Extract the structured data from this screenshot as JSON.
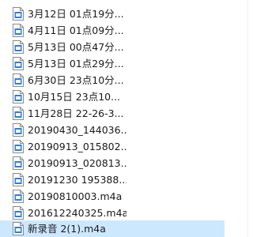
{
  "files": [
    {
      "name": "3月12日 01点19分..."
    },
    {
      "name": "4月11日 01点09分..."
    },
    {
      "name": "5月13日 00点47分..."
    },
    {
      "name": "5月13日 01点29分..."
    },
    {
      "name": "6月30日 23点10分..."
    },
    {
      "name": "10月15日 23点10..."
    },
    {
      "name": "11月28日 22-26-3..."
    },
    {
      "name": "20190430_144036...."
    },
    {
      "name": "20190913_015802...."
    },
    {
      "name": "20190913_020813...."
    },
    {
      "name": "20191230 195388...."
    },
    {
      "name": "20190810003.m4a"
    },
    {
      "name": "201612240325.m4a"
    },
    {
      "name": "新录音 2(1).m4a",
      "selected": true
    }
  ],
  "icon": "audio-file-icon",
  "colors": {
    "selection": "#cce8ff",
    "icon_blue": "#2d7fd3"
  }
}
